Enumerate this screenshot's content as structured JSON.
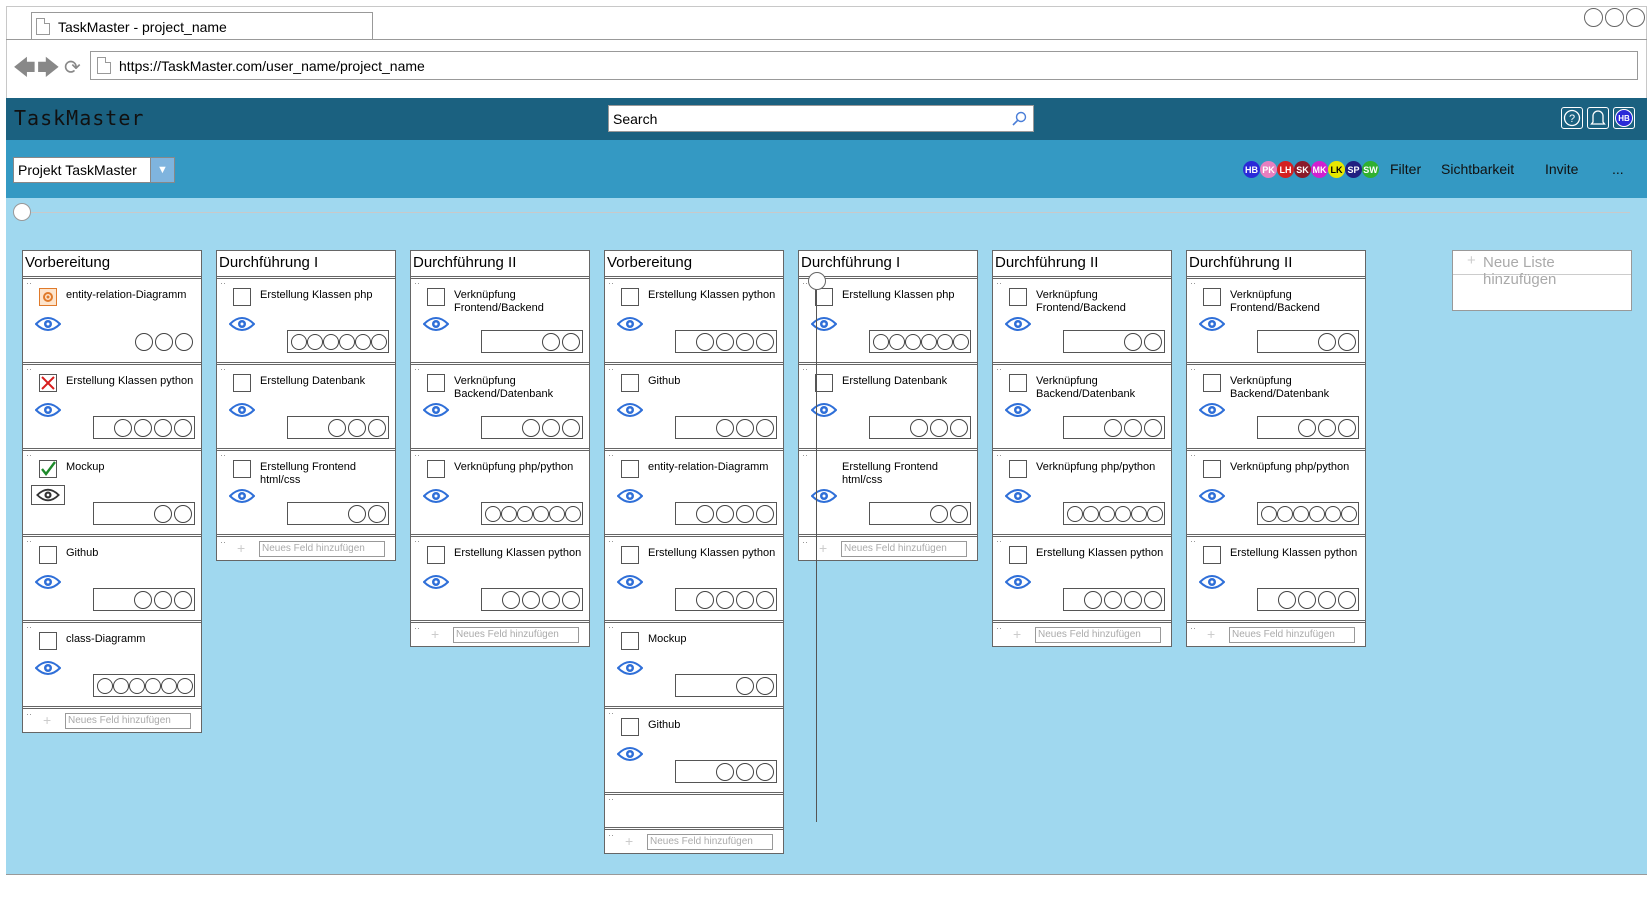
{
  "browser": {
    "tab_title": "TaskMaster - project_name",
    "url": "https://TaskMaster.com/user_name/project_name"
  },
  "header": {
    "logo": "TaskMaster",
    "search_placeholder": "Search",
    "user_initials": "HB"
  },
  "toolbar": {
    "project_select": "Projekt TaskMaster",
    "members": [
      {
        "initials": "HB",
        "color": "#2a2ad8"
      },
      {
        "initials": "PK",
        "color": "#e87fc0"
      },
      {
        "initials": "LH",
        "color": "#d42020"
      },
      {
        "initials": "SK",
        "color": "#8a1a2a"
      },
      {
        "initials": "MK",
        "color": "#d020d0"
      },
      {
        "initials": "LK",
        "color": "#e8e800"
      },
      {
        "initials": "SP",
        "color": "#202080"
      },
      {
        "initials": "SW",
        "color": "#30b030"
      }
    ],
    "filter": "Filter",
    "visibility": "Sichtbarkeit",
    "invite": "Invite",
    "more": "..."
  },
  "add_field_placeholder": "Neues Feld hinzufügen",
  "add_list_label": "Neue Liste hinzufügen",
  "lists": [
    {
      "title": "Vorbereitung",
      "cards": [
        {
          "title": "entity-relation-Diagramm",
          "state": "gear",
          "members": 3,
          "boxed": false
        },
        {
          "title": "Erstellung Klassen python",
          "state": "x",
          "members": 4,
          "boxed": true
        },
        {
          "title": "Mockup",
          "state": "check",
          "members": 2,
          "boxed": true,
          "eye_box": true
        },
        {
          "title": "Github",
          "state": "empty",
          "members": 3,
          "boxed": true
        },
        {
          "title": "class-Diagramm",
          "state": "empty",
          "members": 6,
          "boxed": true
        }
      ]
    },
    {
      "title": "Durchführung I",
      "cards": [
        {
          "title": "Erstellung Klassen php",
          "state": "empty",
          "members": 6,
          "boxed": true
        },
        {
          "title": "Erstellung Datenbank",
          "state": "empty",
          "members": 3,
          "boxed": true
        },
        {
          "title": "Erstellung Frontend html/css",
          "state": "empty",
          "members": 2,
          "boxed": true
        }
      ]
    },
    {
      "title": "Durchführung II",
      "cards": [
        {
          "title": "Verknüpfung Frontend/Backend",
          "state": "empty",
          "members": 2,
          "boxed": true
        },
        {
          "title": "Verknüpfung Backend/Datenbank",
          "state": "empty",
          "members": 3,
          "boxed": true
        },
        {
          "title": "Verknüpfung php/python",
          "state": "empty",
          "members": 6,
          "boxed": true
        },
        {
          "title": "Erstellung Klassen python",
          "state": "empty",
          "members": 4,
          "boxed": true
        }
      ]
    },
    {
      "title": "Vorbereitung",
      "cards": [
        {
          "title": "Erstellung Klassen python",
          "state": "empty",
          "members": 4,
          "boxed": true
        },
        {
          "title": "Github",
          "state": "empty",
          "members": 3,
          "boxed": true
        },
        {
          "title": "entity-relation-Diagramm",
          "state": "empty",
          "members": 4,
          "boxed": true
        },
        {
          "title": "Erstellung Klassen python",
          "state": "empty",
          "members": 4,
          "boxed": true
        },
        {
          "title": "Mockup",
          "state": "empty",
          "members": 2,
          "boxed": true
        },
        {
          "title": "Github",
          "state": "empty",
          "members": 3,
          "boxed": true
        },
        {
          "title": "",
          "state": "placeholder",
          "members": 0,
          "boxed": false
        }
      ]
    },
    {
      "title": "Durchführung I",
      "cards": [
        {
          "title": "Erstellung Klassen php",
          "state": "empty",
          "members": 6,
          "boxed": true
        },
        {
          "title": "Erstellung Datenbank",
          "state": "empty",
          "members": 3,
          "boxed": true
        },
        {
          "title": "Erstellung Frontend html/css",
          "state": "nocb",
          "members": 2,
          "boxed": true
        }
      ]
    },
    {
      "title": "Durchführung II",
      "cards": [
        {
          "title": "Verknüpfung Frontend/Backend",
          "state": "empty",
          "members": 2,
          "boxed": true
        },
        {
          "title": "Verknüpfung Backend/Datenbank",
          "state": "empty",
          "members": 3,
          "boxed": true
        },
        {
          "title": "Verknüpfung php/python",
          "state": "empty",
          "members": 6,
          "boxed": true
        },
        {
          "title": "Erstellung Klassen python",
          "state": "empty",
          "members": 4,
          "boxed": true
        }
      ]
    },
    {
      "title": "Durchführung II",
      "cards": [
        {
          "title": "Verknüpfung Frontend/Backend",
          "state": "empty",
          "members": 2,
          "boxed": true
        },
        {
          "title": "Verknüpfung Backend/Datenbank",
          "state": "empty",
          "members": 3,
          "boxed": true
        },
        {
          "title": "Verknüpfung php/python",
          "state": "empty",
          "members": 6,
          "boxed": true
        },
        {
          "title": "Erstellung Klassen python",
          "state": "empty",
          "members": 4,
          "boxed": true
        }
      ]
    }
  ]
}
